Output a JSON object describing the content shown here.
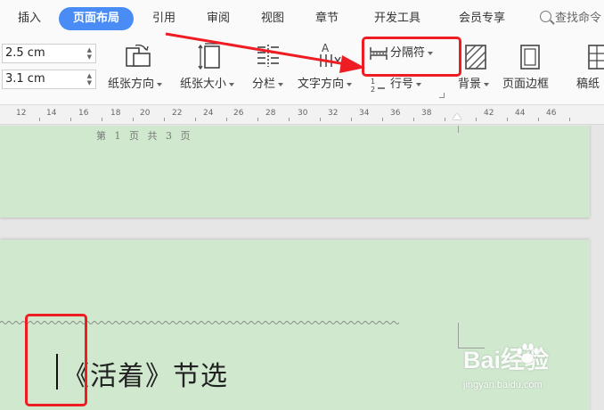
{
  "tabs": [
    {
      "label": "插入",
      "active": false
    },
    {
      "label": "页面布局",
      "active": true
    },
    {
      "label": "引用",
      "active": false
    },
    {
      "label": "审阅",
      "active": false
    },
    {
      "label": "视图",
      "active": false
    },
    {
      "label": "章节",
      "active": false
    },
    {
      "label": "开发工具",
      "active": false
    },
    {
      "label": "会员专享",
      "active": false
    }
  ],
  "search": {
    "placeholder": "查找命令"
  },
  "margins": {
    "top_value": "2.5 cm",
    "bottom_value": "3.1 cm"
  },
  "ribbon": {
    "orientation_label": "纸张方向",
    "size_label": "纸张大小",
    "columns_label": "分栏",
    "text_direction_label": "文字方向",
    "breaks_label": "分隔符",
    "line_numbers_label": "行号",
    "background_label": "背景",
    "page_border_label": "页面边框",
    "paper_label": "稿纸"
  },
  "ruler": {
    "labels": [
      "12",
      "14",
      "16",
      "18",
      "20",
      "22",
      "24",
      "26",
      "28",
      "30",
      "32",
      "34",
      "36",
      "38",
      "42",
      "44",
      "46"
    ]
  },
  "document": {
    "page1_footer": "第 1 页 共 3 页",
    "page2_title": "《活着》节选"
  },
  "watermark": {
    "main": "Bai经验",
    "sub": "jingyan.baidu.com"
  },
  "colors": {
    "page_bg": "#cfe8ce",
    "accent": "#4a8cf5",
    "annotation": "#ee1c23"
  }
}
